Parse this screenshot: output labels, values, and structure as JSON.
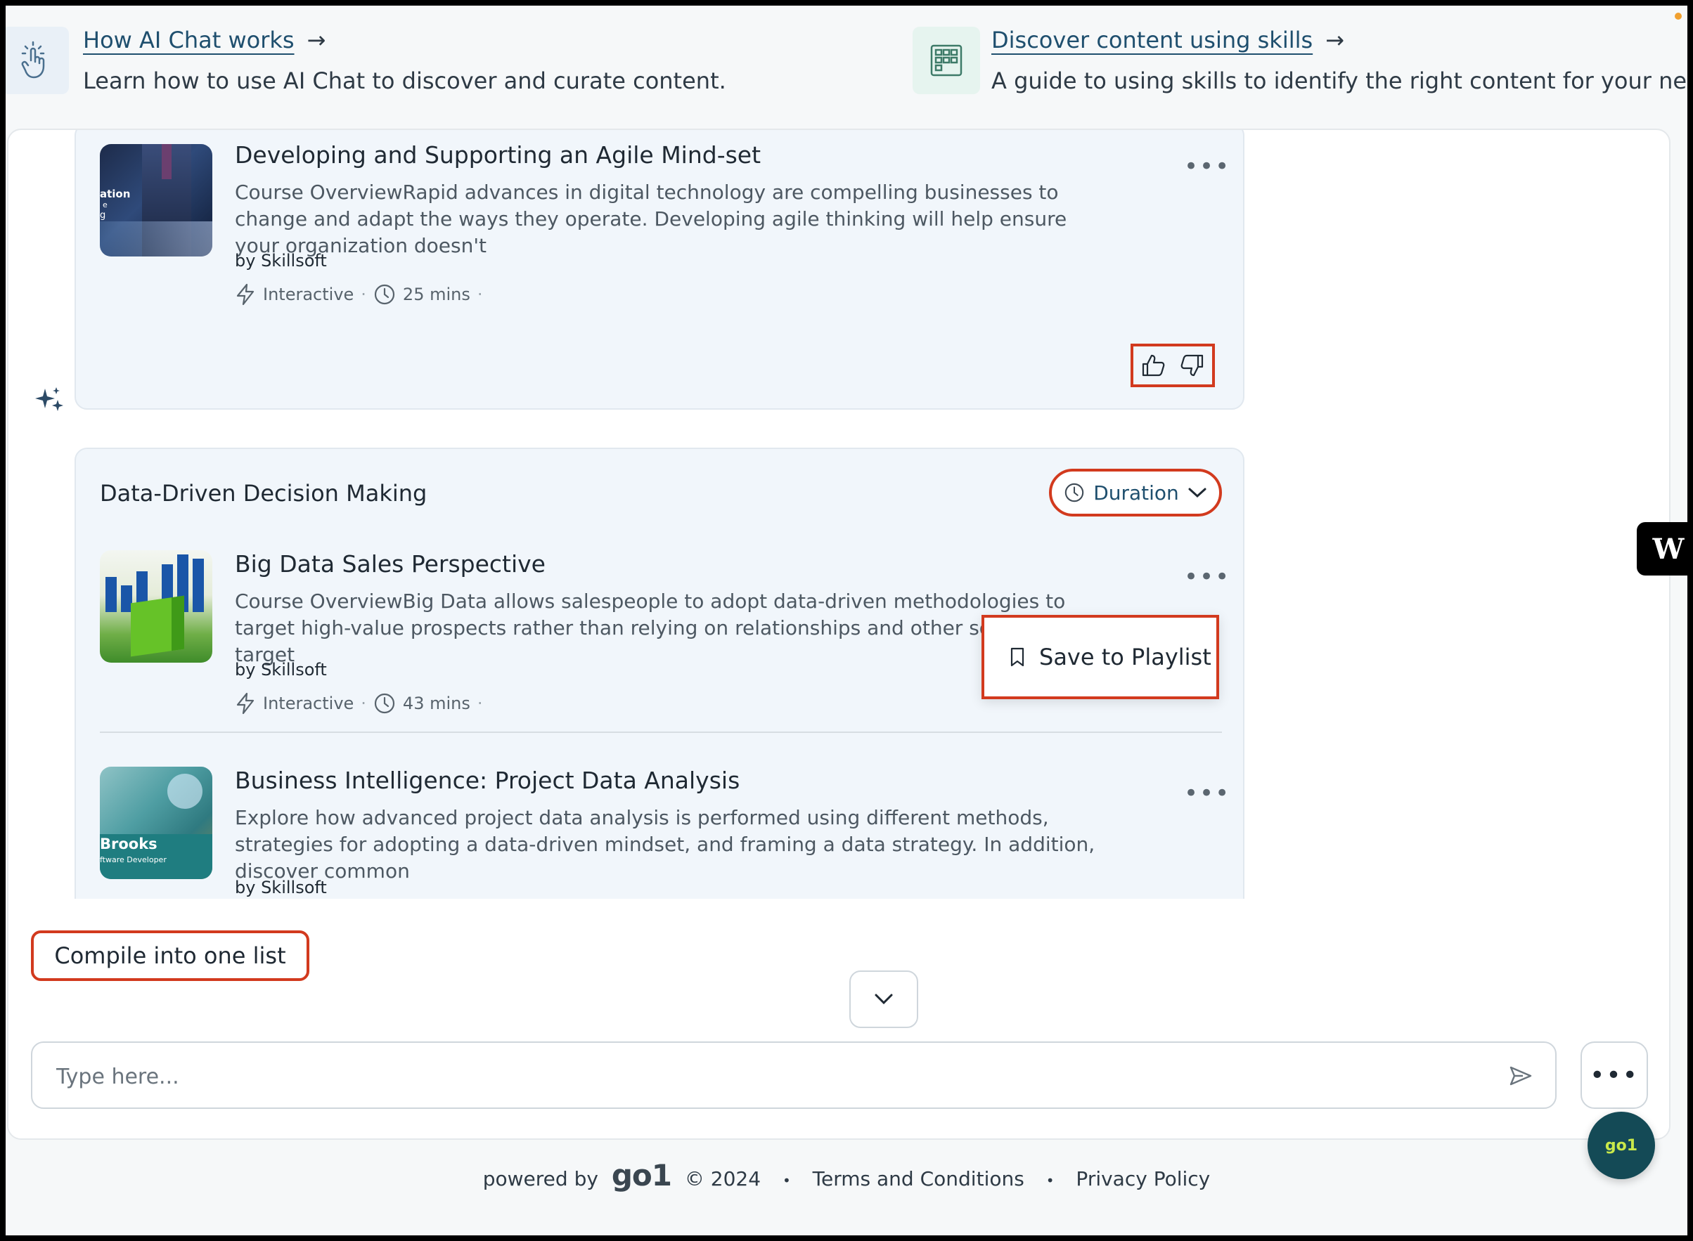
{
  "guides": [
    {
      "title": "How AI Chat works",
      "arrow": "→",
      "desc": "Learn how to use AI Chat to discover and curate content.",
      "icon": "tap-hand-icon"
    },
    {
      "title": "Discover content using skills",
      "arrow": "→",
      "desc": "A guide to using skills to identify the right content for your needs.",
      "icon": "grid-calendar-icon"
    }
  ],
  "card1": {
    "title": "Developing and Supporting an Agile Mind-set",
    "desc": "Course OverviewRapid advances in digital technology are compelling businesses to change and adapt the ways they operate. Developing agile thinking will help ensure your organization doesn't",
    "author": "by Skillsoft",
    "type": "Interactive",
    "duration": "25 mins",
    "thumb_text_1": "ation",
    "thumb_text_2": "e",
    "thumb_text_3": "g",
    "menu": "•••"
  },
  "section": {
    "title": "Data-Driven Decision Making",
    "filter_label": "Duration"
  },
  "course2": {
    "title": "Big Data Sales Perspective",
    "desc": "Course OverviewBig Data allows salespeople to adopt data-driven methodologies to target high-value prospects rather than relying on relationships and other soft factors to target",
    "author": "by Skillsoft",
    "type": "Interactive",
    "duration": "43 mins",
    "menu": "•••"
  },
  "popup": {
    "label": "Save to Playlist"
  },
  "course3": {
    "title": "Business Intelligence: Project Data Analysis",
    "desc": "Explore how advanced project data analysis is performed using different methods, strategies for adopting a data-driven mindset, and framing a data strategy. In addition, discover common",
    "author": "by Skillsoft",
    "thumb_name": "Brooks",
    "thumb_role": "ftware Developer",
    "menu": "•••"
  },
  "compile_button": "Compile into one list",
  "input": {
    "placeholder": "Type here..."
  },
  "more_button": "•••",
  "side_badge": "W",
  "go1_badge": "go1",
  "footer": {
    "powered": "powered by",
    "brand": "go1",
    "year": "© 2024",
    "sep": "•",
    "terms": "Terms and Conditions",
    "privacy": "Privacy Policy"
  },
  "colors": {
    "accent_red": "#d23a1e",
    "brand_dark": "#144a56",
    "card_bg": "#f1f6fb"
  }
}
